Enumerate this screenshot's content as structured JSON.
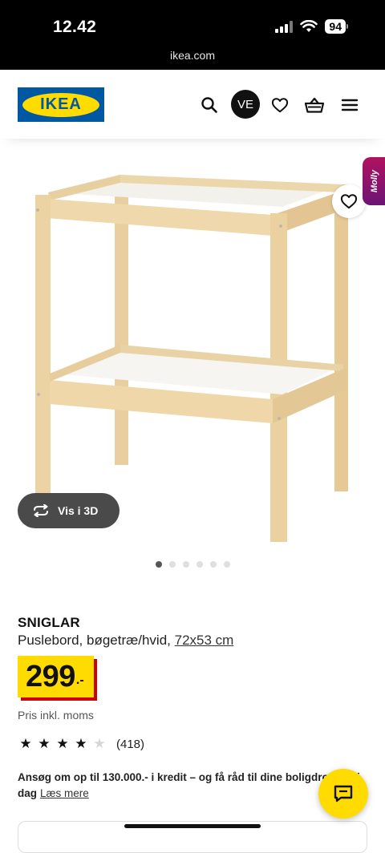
{
  "status_bar": {
    "time": "12.42",
    "battery": "94",
    "url": "ikea.com"
  },
  "header": {
    "logo_text": "IKEA",
    "avatar_initials": "VE",
    "icons": [
      "search-icon",
      "heart-icon",
      "basket-icon",
      "menu-icon"
    ]
  },
  "product_image": {
    "molly_label": "Molly",
    "view_3d_label": "Vis i 3D",
    "carousel_dots": 6,
    "active_dot": 1
  },
  "product": {
    "name": "SNIGLAR",
    "description": "Puslebord, bøgetræ/hvid,",
    "size_link": "72x53 cm",
    "price": "299",
    "price_suffix": ".-",
    "vat_note": "Pris inkl. moms",
    "rating_stars": 4,
    "rating_max": 5,
    "rating_count": "(418)",
    "credit_text": "Ansøg om op til 130.000.- i kredit – og få råd til dine boligdrømme i dag",
    "credit_link": "Læs mere"
  },
  "colors": {
    "ikea_blue": "#0058a3",
    "ikea_yellow": "#ffdb00",
    "price_shadow": "#cc0008",
    "molly_gradient": "#b0125f"
  }
}
